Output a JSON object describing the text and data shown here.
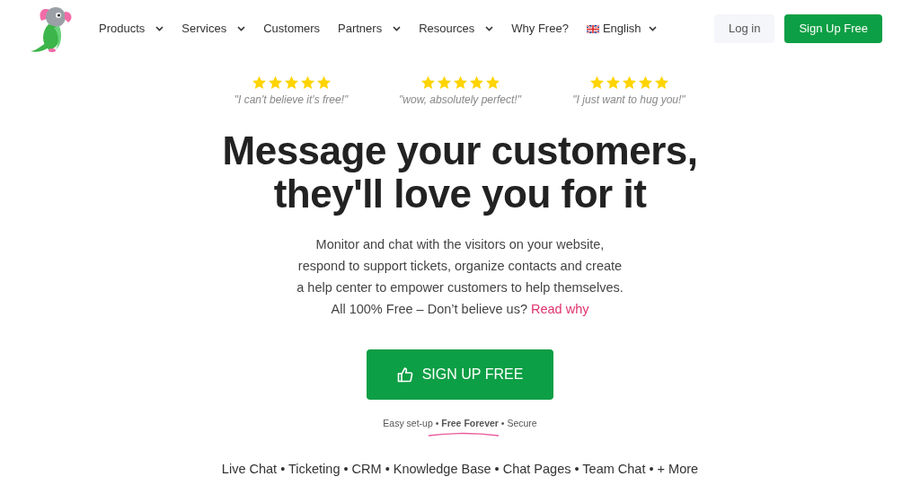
{
  "nav": {
    "items": [
      {
        "label": "Products",
        "dropdown": true
      },
      {
        "label": "Services",
        "dropdown": true
      },
      {
        "label": "Customers",
        "dropdown": false
      },
      {
        "label": "Partners",
        "dropdown": true
      },
      {
        "label": "Resources",
        "dropdown": true
      },
      {
        "label": "Why Free?",
        "dropdown": false
      },
      {
        "label": "English",
        "dropdown": true,
        "kind": "language"
      }
    ],
    "login": "Log in",
    "signup": "Sign Up Free"
  },
  "testimonials": [
    {
      "stars": 5,
      "quote": "\"I can't believe it's free!\""
    },
    {
      "stars": 5,
      "quote": "\"wow, absolutely perfect!\""
    },
    {
      "stars": 5,
      "quote": "\"I just want to hug you!\""
    }
  ],
  "headline": [
    "Message your customers,",
    "they'll love you for it"
  ],
  "description": {
    "lines": [
      "Monitor and chat with the visitors on your website,",
      "respond to support tickets, organize contacts and create",
      "a help center to empower customers to help themselves.",
      "All 100% Free – Don’t believe us?"
    ],
    "link": "Read why"
  },
  "cta": "SIGN UP FREE",
  "tagline": "Easy set-up • **Free Forever** • Secure",
  "features": "Live Chat • Ticketing • CRM • Knowledge Base • Chat Pages • Team Chat • + More"
}
